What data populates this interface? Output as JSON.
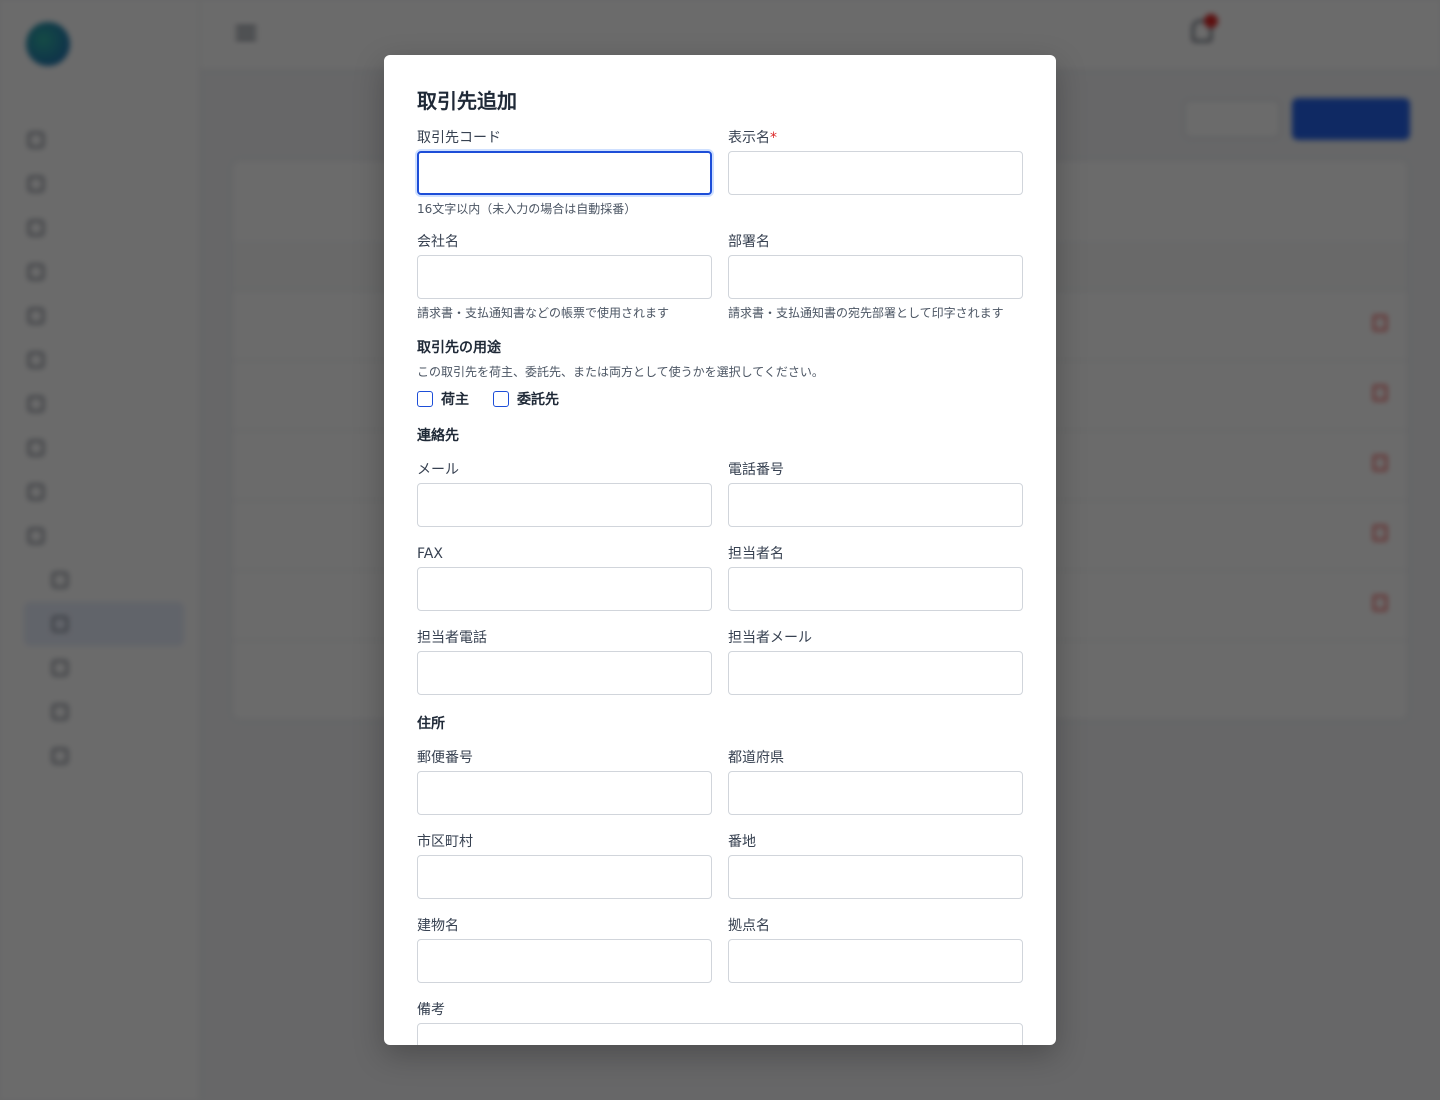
{
  "modal": {
    "title": "取引先追加",
    "fields": {
      "code": {
        "label": "取引先コード",
        "value": "",
        "hint": "16文字以内（未入力の場合は自動採番）"
      },
      "display_name": {
        "label": "表示名",
        "required_mark": "*",
        "value": ""
      },
      "company": {
        "label": "会社名",
        "value": "",
        "hint": "請求書・支払通知書などの帳票で使用されます"
      },
      "department": {
        "label": "部署名",
        "value": "",
        "hint": "請求書・支払通知書の宛先部署として印字されます"
      },
      "email": {
        "label": "メール",
        "value": ""
      },
      "phone": {
        "label": "電話番号",
        "value": ""
      },
      "fax": {
        "label": "FAX",
        "value": ""
      },
      "contact_name": {
        "label": "担当者名",
        "value": ""
      },
      "contact_phone": {
        "label": "担当者電話",
        "value": ""
      },
      "contact_email": {
        "label": "担当者メール",
        "value": ""
      },
      "postal_code": {
        "label": "郵便番号",
        "value": ""
      },
      "prefecture": {
        "label": "都道府県",
        "value": ""
      },
      "city": {
        "label": "市区町村",
        "value": ""
      },
      "street": {
        "label": "番地",
        "value": ""
      },
      "building": {
        "label": "建物名",
        "value": ""
      },
      "site_name": {
        "label": "拠点名",
        "value": ""
      },
      "notes": {
        "label": "備考",
        "value": ""
      }
    },
    "usage": {
      "heading": "取引先の用途",
      "description": "この取引先を荷主、委託先、または両方として使うかを選択してください。",
      "options": [
        {
          "label": "荷主",
          "checked": false
        },
        {
          "label": "委託先",
          "checked": false
        }
      ]
    },
    "sections": {
      "contact": "連絡先",
      "address": "住所"
    }
  },
  "colors": {
    "accent": "#1d4ed8",
    "required": "#dc2626",
    "overlay": "rgba(0,0,0,0.58)"
  }
}
